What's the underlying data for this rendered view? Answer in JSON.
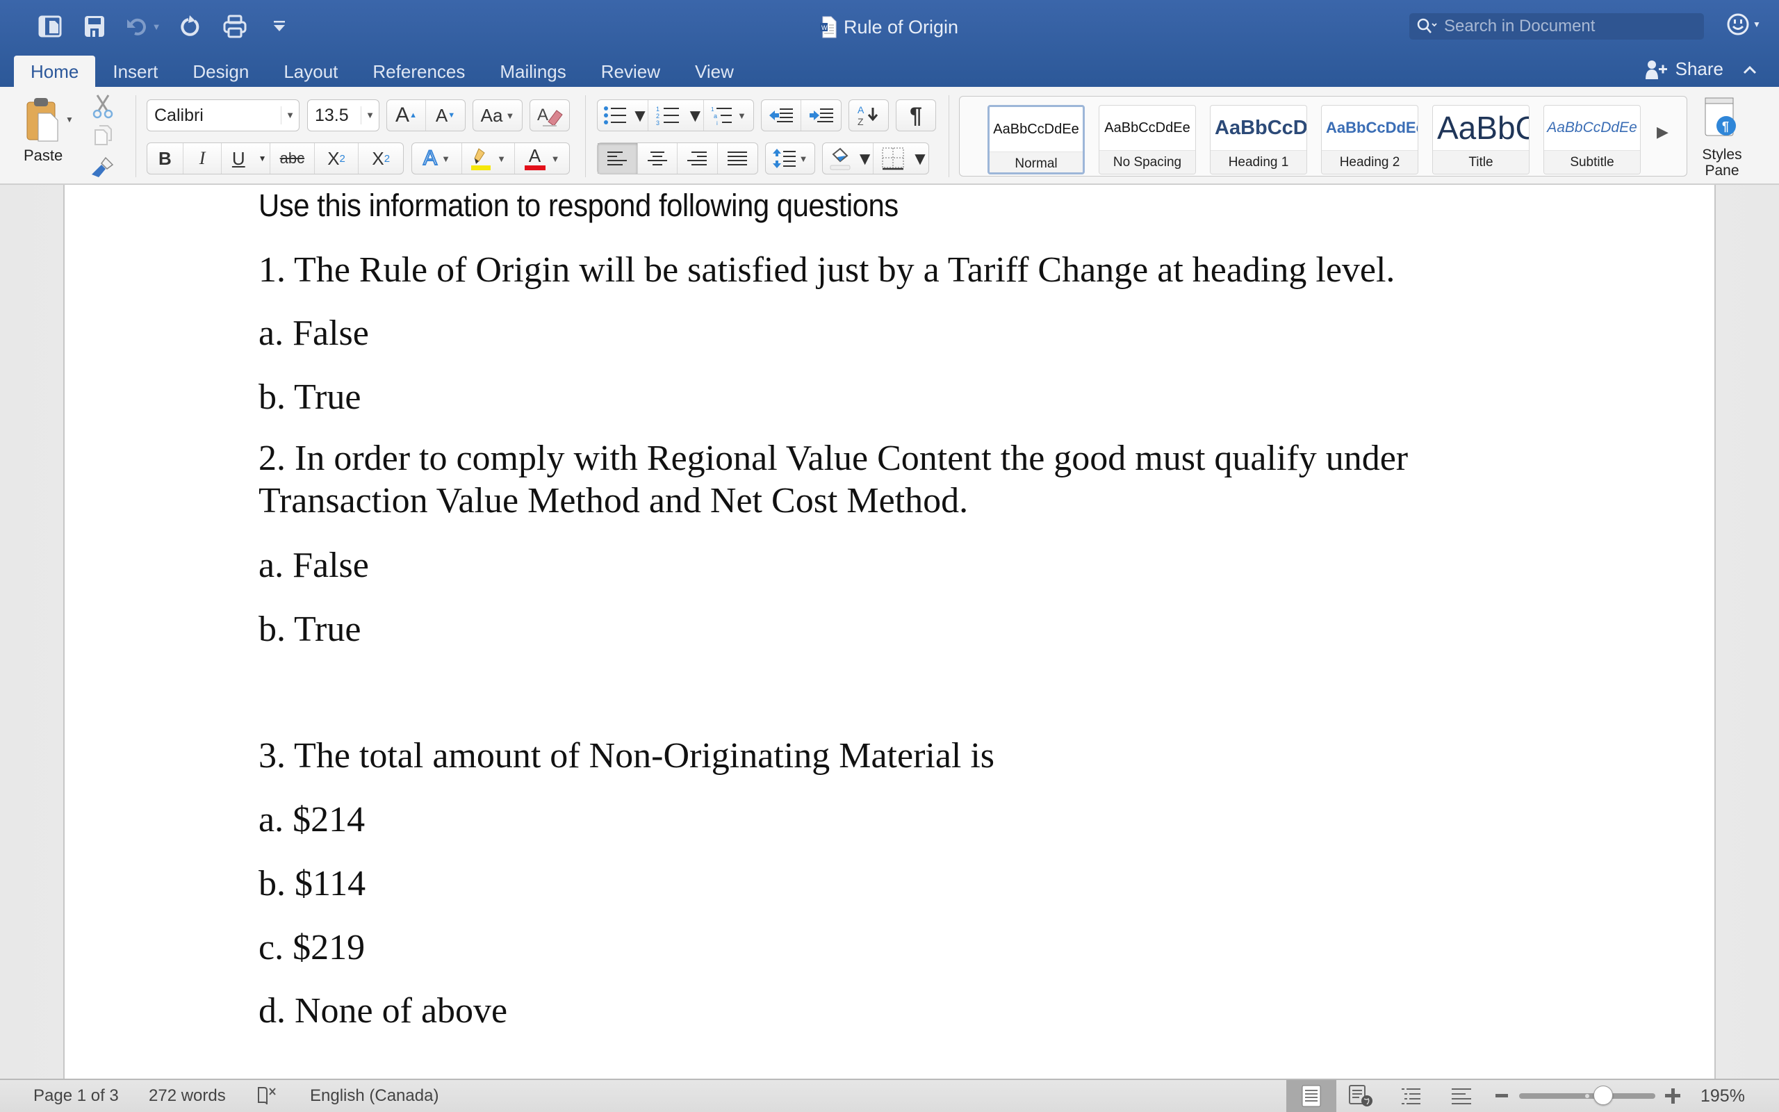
{
  "app": {
    "document_title": "Rule of Origin",
    "search_placeholder": "Search in Document"
  },
  "quick_access": [
    {
      "name": "sidebar-toggle-icon"
    },
    {
      "name": "save-icon"
    },
    {
      "name": "undo-icon",
      "disabled": true
    },
    {
      "name": "redo-icon"
    },
    {
      "name": "print-icon"
    },
    {
      "name": "customize-toolbar-icon"
    }
  ],
  "tabs": [
    {
      "label": "Home",
      "active": true
    },
    {
      "label": "Insert"
    },
    {
      "label": "Design"
    },
    {
      "label": "Layout"
    },
    {
      "label": "References"
    },
    {
      "label": "Mailings"
    },
    {
      "label": "Review"
    },
    {
      "label": "View"
    }
  ],
  "share_label": "Share",
  "ribbon": {
    "paste_label": "Paste",
    "font_name": "Calibri",
    "font_size": "13.5",
    "format_buttons": {
      "bold": "B",
      "italic": "I",
      "underline": "U",
      "strikethrough": "abc",
      "subscript": "X",
      "subscript_sub": "2",
      "superscript": "X",
      "superscript_sup": "2",
      "grow": "A",
      "shrink": "A",
      "change_case": "Aa",
      "text_effects": "A",
      "font_color": "A"
    },
    "colors": {
      "highlight": "#f5e70a",
      "font_color": "#e3101a",
      "accent": "#2b579a"
    },
    "styles": [
      {
        "sample": "AaBbCcDdEe",
        "name": "Normal",
        "selected": true
      },
      {
        "sample": "AaBbCcDdEe",
        "name": "No Spacing"
      },
      {
        "sample": "AaBbCcDd",
        "name": "Heading 1"
      },
      {
        "sample": "AaBbCcDdEe",
        "name": "Heading 2"
      },
      {
        "sample": "AaBbC",
        "name": "Title"
      },
      {
        "sample": "AaBbCcDdEe",
        "name": "Subtitle"
      }
    ],
    "styles_pane_label_1": "Styles",
    "styles_pane_label_2": "Pane"
  },
  "document": {
    "heading": "Use this information to respond following questions",
    "questions": [
      {
        "text": "1. The Rule of Origin will be satisfied just by a Tariff Change at heading level.",
        "options": [
          "a. False",
          "b. True"
        ]
      },
      {
        "text_line1": "2. In order to comply with Regional Value Content the good must qualify under",
        "text_line2": "Transaction Value Method and Net Cost Method.",
        "options": [
          "a. False",
          "b. True"
        ]
      },
      {
        "text": "3. The total amount of Non-Originating Material is",
        "options": [
          "a. $214",
          "b. $114",
          "c. $219",
          "d. None of above"
        ]
      }
    ]
  },
  "status": {
    "page": "Page 1 of 3",
    "words": "272 words",
    "language": "English (Canada)",
    "zoom": "195%",
    "zoom_percent": 195
  }
}
